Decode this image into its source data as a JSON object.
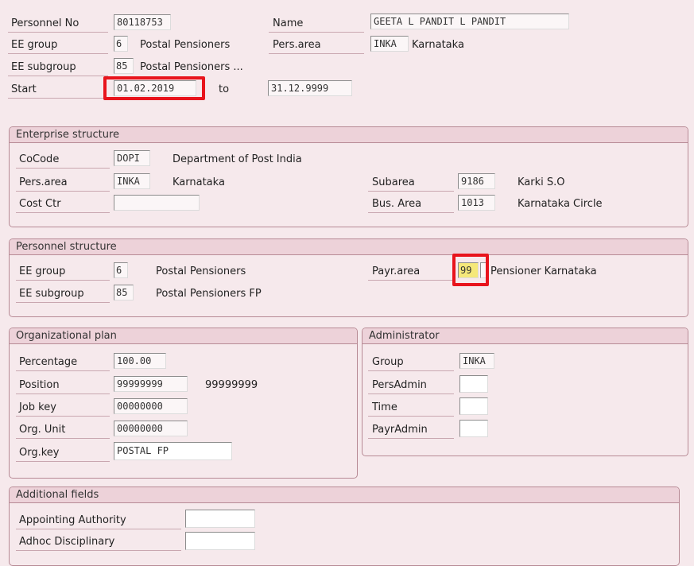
{
  "header": {
    "personnel_no_label": "Personnel No",
    "personnel_no": "80118753",
    "name_label": "Name",
    "name": "GEETA L PANDIT L PANDIT",
    "ee_group_label": "EE group",
    "ee_group_code": "6",
    "ee_group_text": "Postal Pensioners",
    "pers_area_label": "Pers.area",
    "pers_area_code": "INKA",
    "pers_area_text": "Karnataka",
    "ee_subgroup_label": "EE subgroup",
    "ee_subgroup_code": "85",
    "ee_subgroup_text": "Postal Pensioners ...",
    "start_label": "Start",
    "start": "01.02.2019",
    "to_label": "to",
    "end": "31.12.9999"
  },
  "enterprise": {
    "title": "Enterprise structure",
    "cocode_label": "CoCode",
    "cocode": "DOPI",
    "cocode_text": "Department of Post India",
    "pers_area_label": "Pers.area",
    "pers_area": "INKA",
    "pers_area_text": "Karnataka",
    "cost_ctr_label": "Cost Ctr",
    "cost_ctr": "",
    "subarea_label": "Subarea",
    "subarea": "9186",
    "subarea_text": "Karki S.O",
    "bus_area_label": "Bus. Area",
    "bus_area": "1013",
    "bus_area_text": "Karnataka Circle"
  },
  "personnel": {
    "title": "Personnel structure",
    "ee_group_label": "EE group",
    "ee_group": "6",
    "ee_group_text": "Postal Pensioners",
    "ee_subgroup_label": "EE subgroup",
    "ee_subgroup": "85",
    "ee_subgroup_text": "Postal Pensioners FP",
    "payr_area_label": "Payr.area",
    "payr_area": "99",
    "payr_area_text": "Pensioner Karnataka"
  },
  "org_plan": {
    "title": "Organizational plan",
    "percentage_label": "Percentage",
    "percentage": "100.00",
    "position_label": "Position",
    "position": "99999999",
    "position_text": "99999999",
    "job_key_label": "Job key",
    "job_key": "00000000",
    "org_unit_label": "Org. Unit",
    "org_unit": "00000000",
    "org_key_label": "Org.key",
    "org_key": "POSTAL FP"
  },
  "administrator": {
    "title": "Administrator",
    "group_label": "Group",
    "group": "INKA",
    "pers_admin_label": "PersAdmin",
    "pers_admin": "",
    "time_label": "Time",
    "time": "",
    "payr_admin_label": "PayrAdmin",
    "payr_admin": ""
  },
  "additional": {
    "title": "Additional fields",
    "appointing_label": "Appointing Authority",
    "appointing": "",
    "adhoc_label": "Adhoc Disciplinary",
    "adhoc": ""
  },
  "colors": {
    "highlight": "#e8141c",
    "focus_field": "#f5e87a",
    "group_header": "#edd2d9"
  }
}
